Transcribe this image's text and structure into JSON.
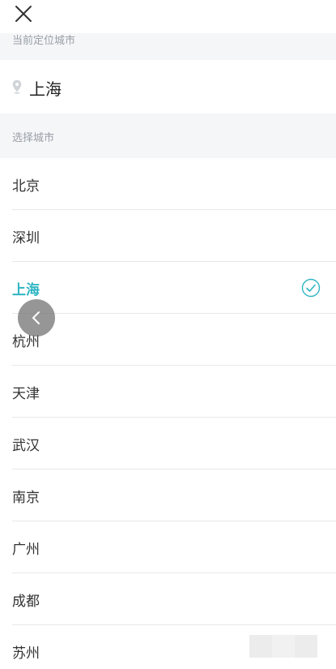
{
  "header": {
    "close_icon": "close-icon"
  },
  "current_location": {
    "section_label": "当前定位城市",
    "pin_icon": "location-pin-icon",
    "city": "上海"
  },
  "city_selection": {
    "section_label": "选择城市",
    "selected_index": 2,
    "accent_color": "#2fb5c4",
    "check_icon": "check-circle-icon",
    "cities": [
      "北京",
      "深圳",
      "上海",
      "杭州",
      "天津",
      "武汉",
      "南京",
      "广州",
      "成都",
      "苏州"
    ]
  },
  "overlay": {
    "back_icon": "chevron-left-icon"
  }
}
